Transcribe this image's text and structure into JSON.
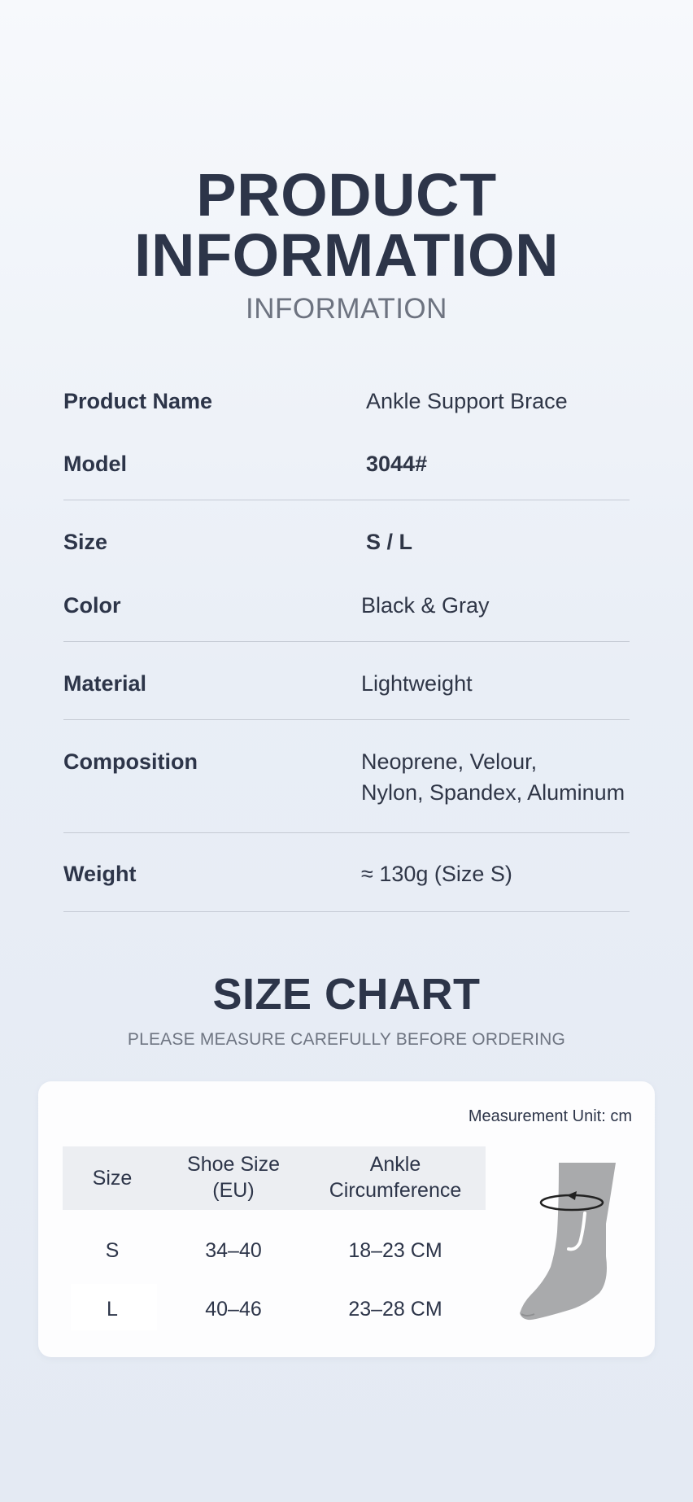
{
  "header": {
    "title_line1": "PRODUCT",
    "title_line2": "INFORMATION",
    "subtitle": "INFORMATION"
  },
  "info": {
    "product_name_label": "Product Name",
    "product_name_value": "Ankle Support Brace",
    "model_label": "Model",
    "model_value": "3044#",
    "size_label": "Size",
    "size_value": "S / L",
    "color_label": "Color",
    "color_value": "Black & Gray",
    "material_label": "Material",
    "material_value": "Lightweight",
    "composition_label": "Composition",
    "composition_value_line1": "Neoprene, Velour,",
    "composition_value_line2": "Nylon, Spandex, Aluminum",
    "weight_label": "Weight",
    "weight_value": "≈ 130g (Size S)"
  },
  "size_chart": {
    "title": "SIZE CHART",
    "subtitle": "PLEASE MEASURE CAREFULLY BEFORE ORDERING",
    "unit": "Measurement Unit: cm",
    "headers": {
      "size": "Size",
      "shoe_line1": "Shoe Size",
      "shoe_line2": "(EU)",
      "ankle_line1": "Ankle",
      "ankle_line2": "Circumference"
    },
    "rows": [
      {
        "size": "S",
        "shoe": "34–40",
        "ankle": "18–23 CM"
      },
      {
        "size": "L",
        "shoe": "40–46",
        "ankle": "23–28 CM"
      }
    ],
    "illustration_icon": "ankle-measure-icon"
  }
}
